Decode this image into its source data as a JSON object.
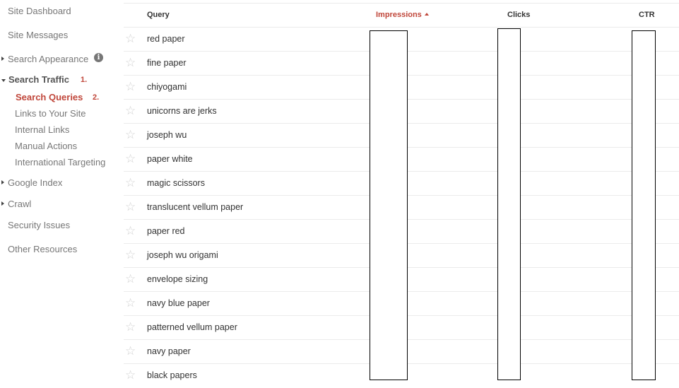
{
  "sidebar": {
    "items": [
      {
        "label": "Site Dashboard"
      },
      {
        "label": "Site Messages"
      },
      {
        "label": "Search Appearance",
        "icon": "info-icon"
      },
      {
        "label": "Search Traffic",
        "annotation": "1."
      },
      {
        "label": "Google Index"
      },
      {
        "label": "Crawl"
      },
      {
        "label": "Security Issues"
      },
      {
        "label": "Other Resources"
      }
    ],
    "search_traffic_subitems": [
      {
        "label": "Search Queries",
        "annotation": "2.",
        "active": true
      },
      {
        "label": "Links to Your Site"
      },
      {
        "label": "Internal Links"
      },
      {
        "label": "Manual Actions"
      },
      {
        "label": "International Targeting"
      }
    ],
    "info_glyph": "i"
  },
  "table": {
    "columns": {
      "query": "Query",
      "impressions": "Impressions",
      "clicks": "Clicks",
      "ctr": "CTR"
    },
    "sorted_column": "impressions",
    "star_glyph": "☆",
    "rows": [
      {
        "query": "red paper"
      },
      {
        "query": "fine paper"
      },
      {
        "query": "chiyogami"
      },
      {
        "query": "unicorns are jerks"
      },
      {
        "query": "joseph wu"
      },
      {
        "query": "paper white"
      },
      {
        "query": "magic scissors"
      },
      {
        "query": "translucent vellum paper"
      },
      {
        "query": "paper red"
      },
      {
        "query": "joseph wu origami"
      },
      {
        "query": "envelope sizing"
      },
      {
        "query": "navy blue paper"
      },
      {
        "query": "patterned vellum paper"
      },
      {
        "query": "navy paper"
      },
      {
        "query": "black papers"
      }
    ]
  },
  "colors": {
    "accent": "#c0463a",
    "nav_text": "#777777",
    "body_text": "#333333"
  }
}
